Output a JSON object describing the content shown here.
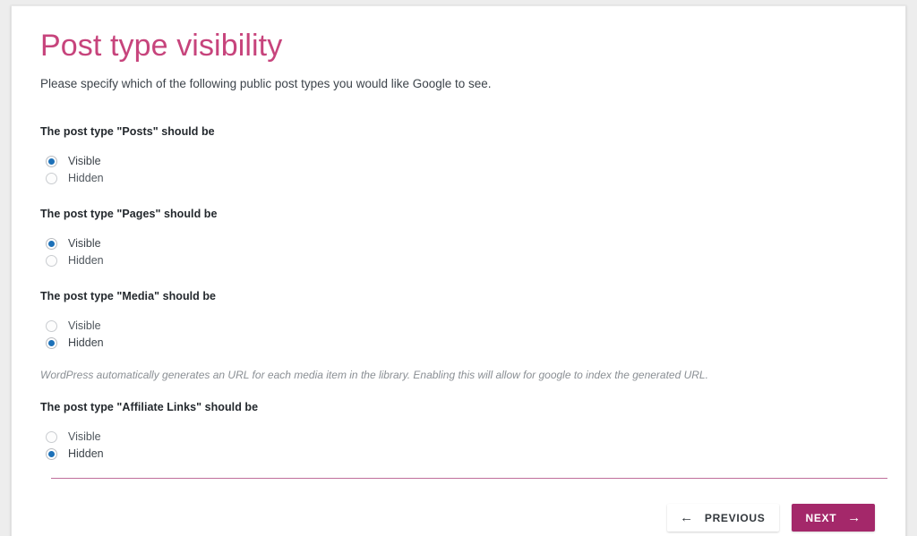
{
  "page": {
    "title": "Post type visibility",
    "subtitle": "Please specify which of the following public post types you would like Google to see."
  },
  "groups": [
    {
      "legend": "The post type \"Posts\" should be",
      "options": [
        {
          "label": "Visible",
          "selected": true
        },
        {
          "label": "Hidden",
          "selected": false
        }
      ],
      "help": ""
    },
    {
      "legend": "The post type \"Pages\" should be",
      "options": [
        {
          "label": "Visible",
          "selected": true
        },
        {
          "label": "Hidden",
          "selected": false
        }
      ],
      "help": ""
    },
    {
      "legend": "The post type \"Media\" should be",
      "options": [
        {
          "label": "Visible",
          "selected": false
        },
        {
          "label": "Hidden",
          "selected": true
        }
      ],
      "help": "WordPress automatically generates an URL for each media item in the library. Enabling this will allow for google to index the generated URL."
    },
    {
      "legend": "The post type \"Affiliate Links\" should be",
      "options": [
        {
          "label": "Visible",
          "selected": false
        },
        {
          "label": "Hidden",
          "selected": true
        }
      ],
      "help": ""
    }
  ],
  "footer": {
    "previous_label": "PREVIOUS",
    "previous_icon": "arrow-left-icon",
    "next_label": "NEXT",
    "next_icon": "arrow-right-icon"
  },
  "colors": {
    "title": "#c7447c",
    "accent": "#a4286a",
    "divider": "#c06f9b",
    "radio_selected": "#1d71b8"
  }
}
